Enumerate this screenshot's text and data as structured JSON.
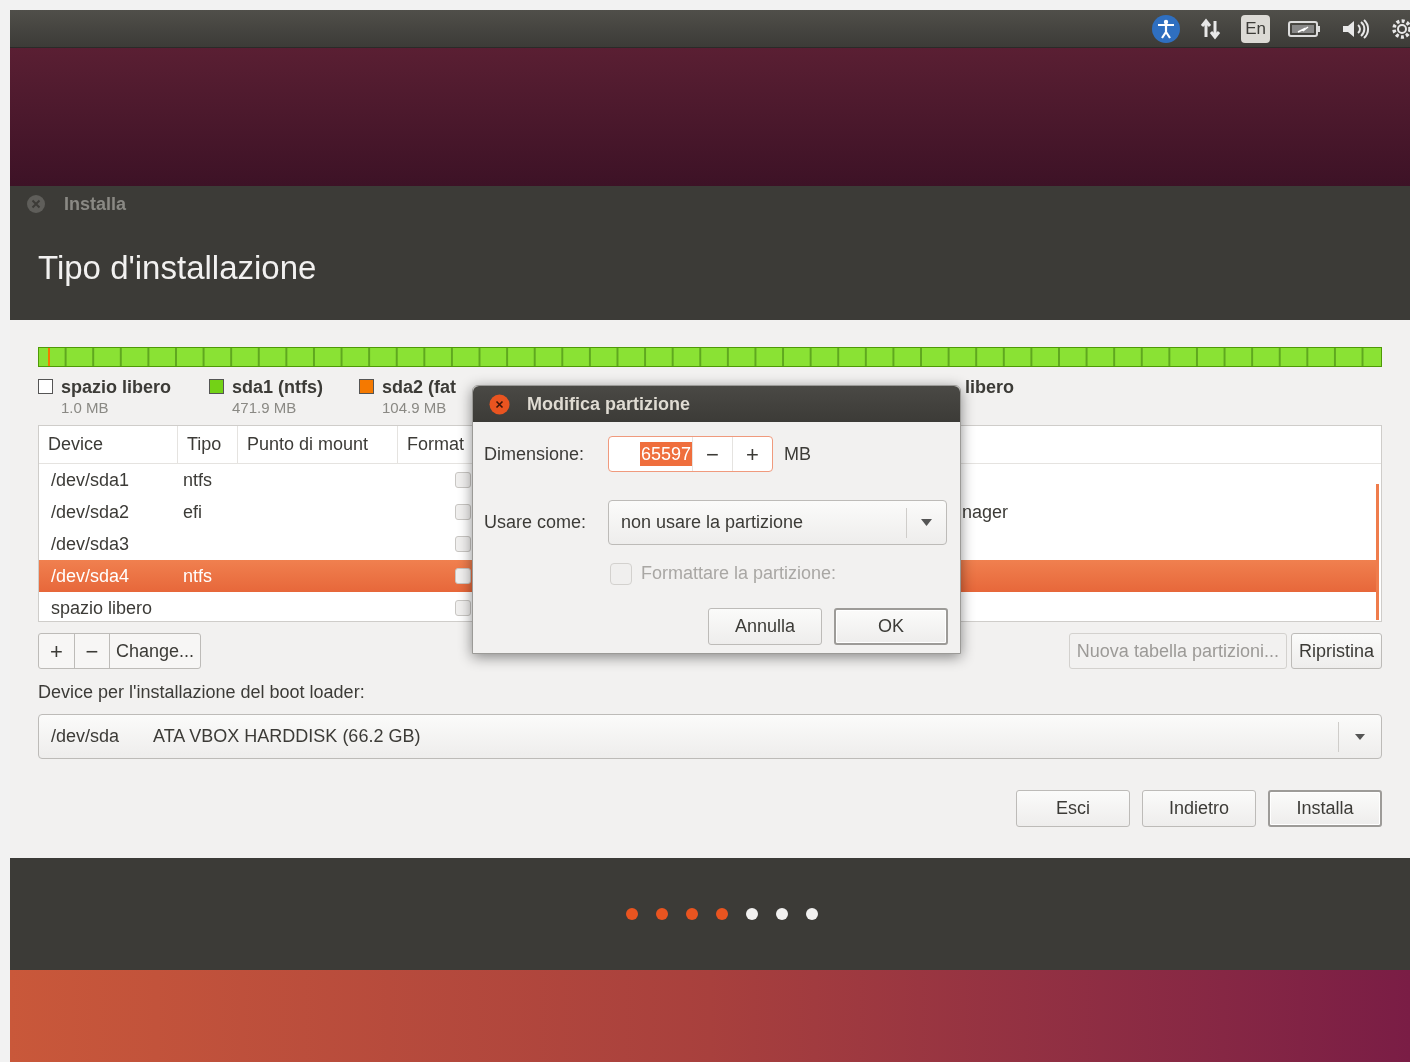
{
  "top_panel": {
    "keyboard_indicator": "En"
  },
  "window": {
    "title": "Installa",
    "heading": "Tipo d'installazione"
  },
  "partition_legend": [
    {
      "label": "spazio libero",
      "size": "1.0 MB",
      "color": "#ffffff"
    },
    {
      "label": "sda1 (ntfs)",
      "size": "471.9 MB",
      "color": "#73d216"
    },
    {
      "label": "sda2 (fat",
      "size": "104.9 MB",
      "color": "#f57900"
    },
    {
      "label": "libero"
    }
  ],
  "table": {
    "columns": [
      "Device",
      "Tipo",
      "Punto di mount",
      "Format"
    ],
    "rows": [
      {
        "device": "/dev/sda1",
        "type": "ntfs",
        "format_checked": false,
        "selected": false
      },
      {
        "device": "/dev/sda2",
        "type": "efi",
        "format_checked": false,
        "column_6": "nager",
        "selected": false
      },
      {
        "device": "/dev/sda3",
        "format_checked": false,
        "selected": false
      },
      {
        "device": "/dev/sda4",
        "type": "ntfs",
        "format_checked": false,
        "selected": true
      },
      {
        "device": "spazio libero",
        "format_checked": false,
        "selected": false
      }
    ]
  },
  "table_buttons": [
    "+",
    "−",
    "Change..."
  ],
  "right_buttons": [
    {
      "label": "Nuova tabella partizioni...",
      "disabled": true
    },
    {
      "label": "Ripristina",
      "disabled": false
    }
  ],
  "boot_loader": {
    "label": "Device per l'installazione del boot loader:",
    "device": "/dev/sda",
    "description": "ATA VBOX HARDDISK (66.2 GB)"
  },
  "nav_buttons": [
    {
      "label": "Esci",
      "default": false
    },
    {
      "label": "Indietro",
      "default": false
    },
    {
      "label": "Installa",
      "default": true
    }
  ],
  "progress_dots": [
    {
      "done": true
    },
    {
      "done": true
    },
    {
      "done": true
    },
    {
      "done": true
    },
    {
      "done": false
    },
    {
      "done": false
    },
    {
      "done": false
    }
  ],
  "dialog": {
    "title": "Modifica partizione",
    "size_label": "Dimensione:",
    "size_value": "65597",
    "minus": "−",
    "plus": "+",
    "unit": "MB",
    "use_label": "Usare come:",
    "use_value": "non usare la partizione",
    "format_label": "Formattare la partizione:",
    "format_checked": false,
    "format_disabled": true,
    "buttons": [
      {
        "label": "Annulla",
        "default": false
      },
      {
        "label": "OK",
        "default": true
      }
    ]
  }
}
